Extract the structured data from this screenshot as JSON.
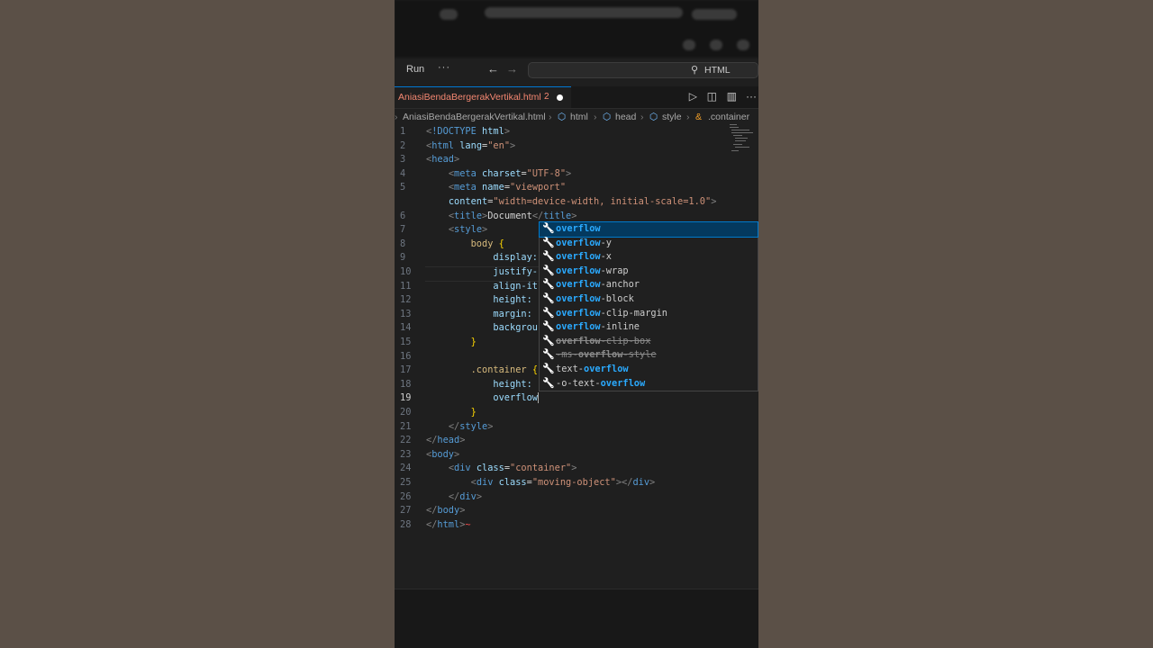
{
  "top": {
    "run_label": "Run",
    "more_label": "···",
    "back_icon": "arrow-left-icon",
    "forward_icon": "arrow-right-icon",
    "search_text": "HTML"
  },
  "tab": {
    "filename": "AniasiBendaBergerakVertikal.html",
    "problem_count": "2"
  },
  "breadcrumb": {
    "file": "AniasiBendaBergerakVertikal.html",
    "html": "html",
    "head": "head",
    "style": "style",
    "selector": ".container"
  },
  "editor": {
    "lines": [
      {
        "n": "1",
        "c": "<!DOCTYPE html>"
      },
      {
        "n": "2",
        "c": "<html lang=\"en\">"
      },
      {
        "n": "3",
        "c": "<head>"
      },
      {
        "n": "4",
        "c": "    <meta charset=\"UTF-8\">"
      },
      {
        "n": "5",
        "c": "    <meta name=\"viewport\""
      },
      {
        "n": "",
        "c": "    content=\"width=device-width, initial-scale=1.0\">"
      },
      {
        "n": "6",
        "c": "    <title>Document</title>"
      },
      {
        "n": "7",
        "c": "    <style>"
      },
      {
        "n": "8",
        "c": "        body {"
      },
      {
        "n": "9",
        "c": "            display:"
      },
      {
        "n": "10",
        "c": "            justify-"
      },
      {
        "n": "11",
        "c": "            align-it"
      },
      {
        "n": "12",
        "c": "            height:"
      },
      {
        "n": "13",
        "c": "            margin:"
      },
      {
        "n": "14",
        "c": "            backgrou"
      },
      {
        "n": "15",
        "c": "        }"
      },
      {
        "n": "16",
        "c": ""
      },
      {
        "n": "17",
        "c": "        .container {"
      },
      {
        "n": "18",
        "c": "            height:"
      },
      {
        "n": "19",
        "c": "            overflow"
      },
      {
        "n": "20",
        "c": "        }"
      },
      {
        "n": "21",
        "c": "    </style>"
      },
      {
        "n": "22",
        "c": "</head>"
      },
      {
        "n": "23",
        "c": "<body>"
      },
      {
        "n": "24",
        "c": "    <div class=\"container\">"
      },
      {
        "n": "25",
        "c": "        <div class=\"moving-object\"></div>"
      },
      {
        "n": "26",
        "c": "    </div>"
      },
      {
        "n": "27",
        "c": "</body>"
      },
      {
        "n": "28",
        "c": "</html>"
      }
    ]
  },
  "suggestions": [
    {
      "match": "overflow",
      "rest": "",
      "pre": ""
    },
    {
      "match": "overflow",
      "rest": "-y",
      "pre": ""
    },
    {
      "match": "overflow",
      "rest": "-x",
      "pre": ""
    },
    {
      "match": "overflow",
      "rest": "-wrap",
      "pre": ""
    },
    {
      "match": "overflow",
      "rest": "-anchor",
      "pre": ""
    },
    {
      "match": "overflow",
      "rest": "-block",
      "pre": ""
    },
    {
      "match": "overflow",
      "rest": "-clip-margin",
      "pre": ""
    },
    {
      "match": "overflow",
      "rest": "-inline",
      "pre": ""
    },
    {
      "match": "overflow",
      "rest": "-clip-box",
      "pre": ""
    },
    {
      "match": "overflow",
      "rest": "-style",
      "pre": "-ms-"
    },
    {
      "match": "overflow",
      "rest": "",
      "pre": "text-"
    },
    {
      "match": "overflow",
      "rest": "",
      "pre": "-o-text-"
    }
  ],
  "colors": {
    "accent": "#0078d4",
    "error_tab": "#f48771",
    "match_highlight": "#2aaaff"
  }
}
